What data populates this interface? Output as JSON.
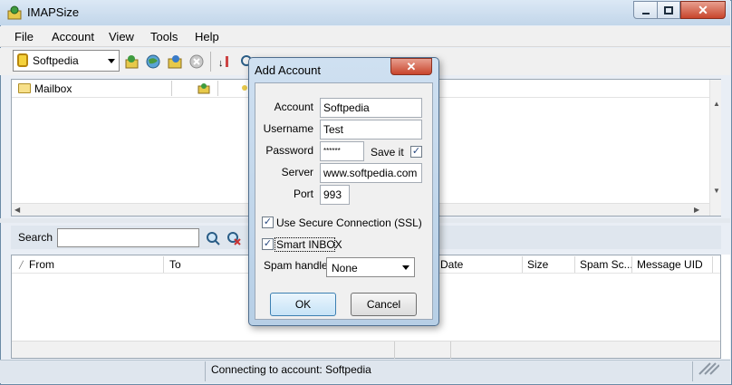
{
  "window": {
    "title": "IMAPSize"
  },
  "menu": [
    "File",
    "Account",
    "View",
    "Tools",
    "Help"
  ],
  "toolbar": {
    "account_selected": "Softpedia"
  },
  "tree": {
    "column_header": "Mailbox"
  },
  "search": {
    "label": "Search",
    "value": ""
  },
  "messages": {
    "columns": [
      "From",
      "To",
      "Date",
      "Size",
      "Spam Sc...",
      "Message UID"
    ]
  },
  "status": {
    "text": "Connecting to account: Softpedia"
  },
  "dialog": {
    "title": "Add Account",
    "close": "✕",
    "fields": {
      "account_label": "Account",
      "account_value": "Softpedia",
      "username_label": "Username",
      "username_value": "Test",
      "password_label": "Password",
      "password_value": "******",
      "saveit_label": "Save it",
      "server_label": "Server",
      "server_value": "www.softpedia.com",
      "port_label": "Port",
      "port_value": "993"
    },
    "checkboxes": {
      "ssl_label": "Use Secure Connection (SSL)",
      "ssl_checked": true,
      "smart_inbox_label": "Smart INBOX",
      "smart_inbox_checked": true,
      "save_it_checked": true
    },
    "spam": {
      "label": "Spam handle",
      "value": "None"
    },
    "buttons": {
      "ok": "OK",
      "cancel": "Cancel"
    }
  },
  "colors": {
    "accent": "#3c7fb1",
    "close_red": "#c8452c"
  }
}
